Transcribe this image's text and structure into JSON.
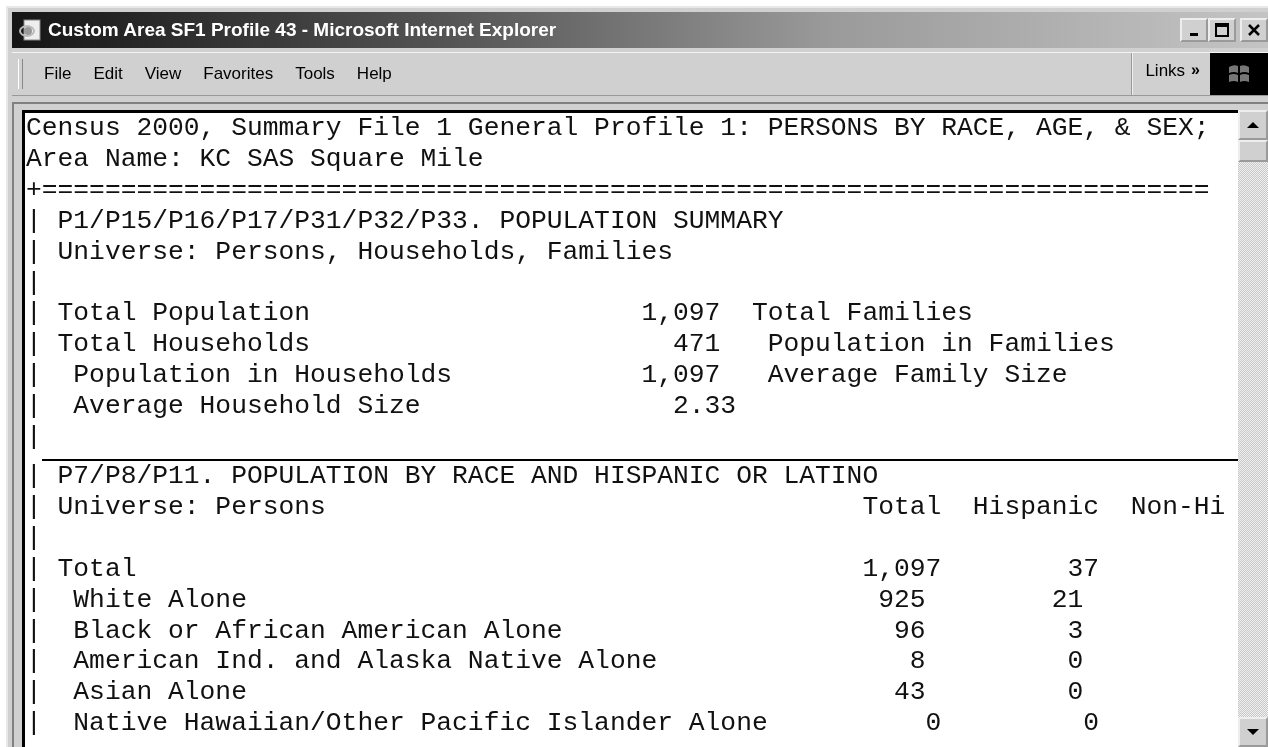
{
  "window": {
    "title": "Custom Area SF1 Profile 43 - Microsoft Internet Explorer"
  },
  "menu": [
    "File",
    "Edit",
    "View",
    "Favorites",
    "Tools",
    "Help"
  ],
  "links": {
    "label": "Links",
    "chevron": "»"
  },
  "document": {
    "header_lines": [
      "Census 2000, Summary File 1 General Profile 1: PERSONS BY RACE, AGE, & SEX;",
      "Area Name: KC SAS Square Mile"
    ],
    "rule": "+==========================================================================",
    "sections": [
      {
        "lines": [
          "| P1/P15/P16/P17/P31/P32/P33. POPULATION SUMMARY",
          "| Universe: Persons, Households, Families",
          "|",
          "| Total Population                     1,097  Total Families",
          "| Total Households                       471   Population in Families",
          "|  Population in Households            1,097   Average Family Size",
          "|  Average Household Size                2.33",
          "|"
        ]
      },
      {
        "lines": [
          "| P7/P8/P11. POPULATION BY RACE AND HISPANIC OR LATINO",
          "| Universe: Persons                                  Total  Hispanic  Non-Hi",
          "|",
          "| Total                                              1,097        37",
          "|  White Alone                                        925        21",
          "|  Black or African American Alone                     96         3",
          "|  American Ind. and Alaska Native Alone                8         0",
          "|  Asian Alone                                         43         0",
          "|  Native Hawaiian/Other Pacific Islander Alone          0         0"
        ]
      }
    ]
  }
}
